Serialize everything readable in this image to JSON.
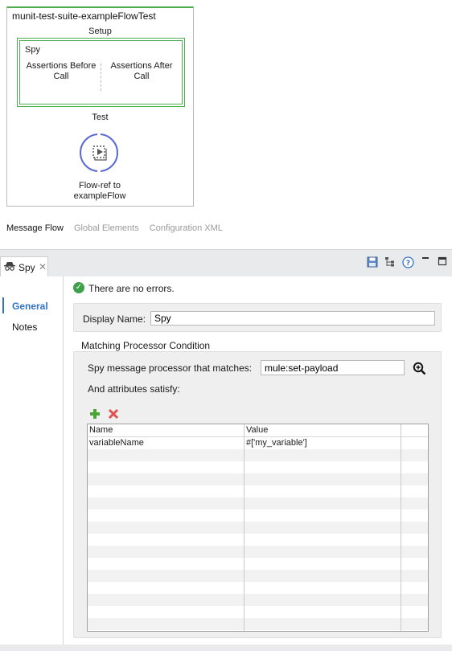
{
  "flow": {
    "title": "munit-test-suite-exampleFlowTest",
    "setup_label": "Setup",
    "spy_label": "Spy",
    "assertions_before": "Assertions Before Call",
    "assertions_after": "Assertions After Call",
    "test_label": "Test",
    "flowref_label": "Flow-ref to exampleFlow"
  },
  "view_tabs": {
    "message_flow": "Message Flow",
    "global_elements": "Global Elements",
    "configuration_xml": "Configuration XML"
  },
  "panel": {
    "tab_label": "Spy",
    "tab_close": "✕",
    "nav": {
      "general": "General",
      "notes": "Notes"
    },
    "status_text": "There are no errors.",
    "display_name_label": "Display Name:",
    "display_name_value": "Spy",
    "mpc_title": "Matching Processor Condition",
    "spy_matches_label": "Spy message processor that matches:",
    "spy_matches_value": "mule:set-payload",
    "attributes_label": "And attributes satisfy:",
    "table": {
      "headers": [
        "Name",
        "Value"
      ],
      "rows": [
        {
          "name": "variableName",
          "value": "#['my_variable']"
        }
      ]
    }
  },
  "colors": {
    "accent_green": "#4cae4c",
    "flowref_blue": "#5b6bd6",
    "nav_active": "#2f73c6",
    "ok_green": "#3ea04a",
    "remove_red": "#e05050"
  },
  "icons": {
    "tab": "spy-icon",
    "header_buttons": [
      "save-icon",
      "tree-icon",
      "help-icon",
      "minimize-icon",
      "maximize-icon"
    ],
    "zoom": "zoom-in-icon",
    "add": "add-icon",
    "remove": "remove-icon",
    "status": "check-circle-icon",
    "flowref": "flow-ref-icon"
  }
}
